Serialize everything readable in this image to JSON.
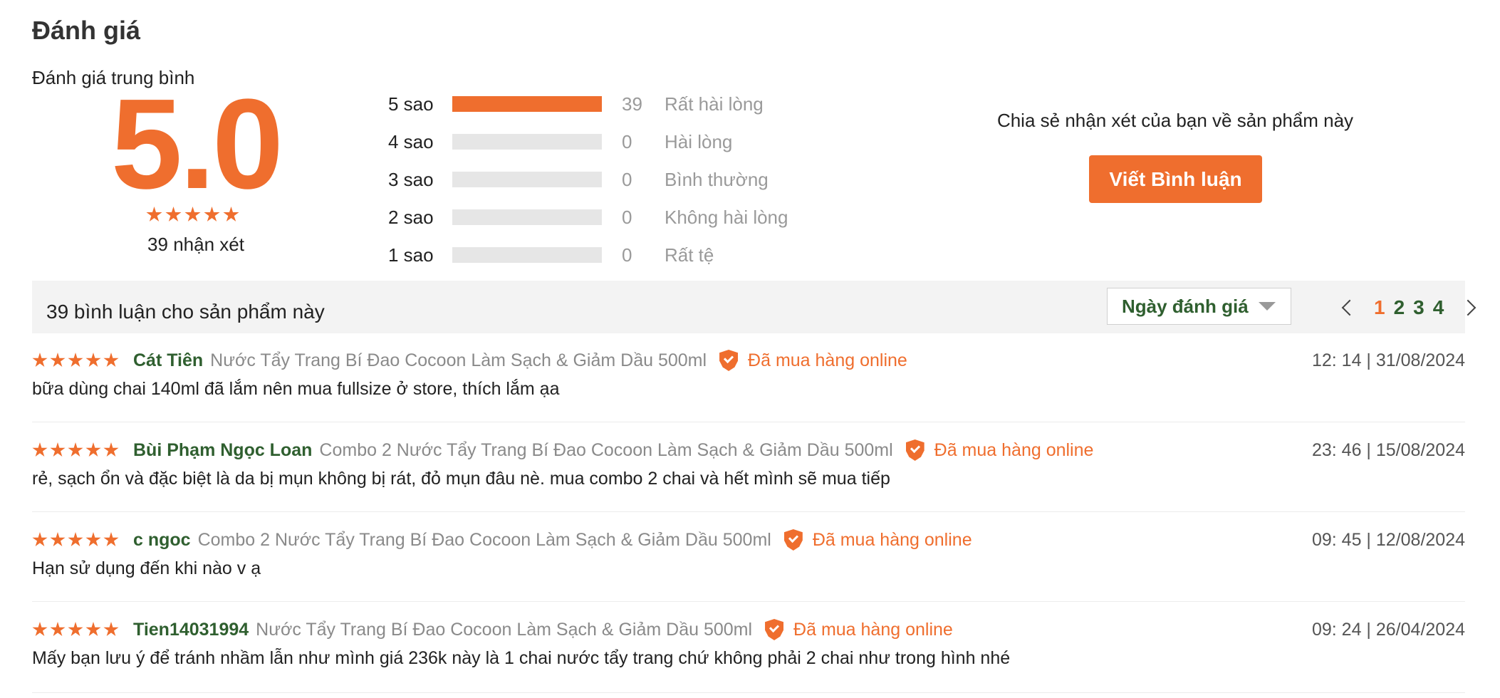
{
  "title": "Đánh giá",
  "summary": {
    "avg_label": "Đánh giá trung bình",
    "avg_value": "5.0",
    "rating": 5,
    "count_text": "39 nhận xét"
  },
  "distribution": [
    {
      "label": "5 sao",
      "count": "39",
      "text": "Rất hài lòng",
      "fraction": 1.0
    },
    {
      "label": "4 sao",
      "count": "0",
      "text": "Hài lòng",
      "fraction": 0
    },
    {
      "label": "3 sao",
      "count": "0",
      "text": "Bình thường",
      "fraction": 0
    },
    {
      "label": "2 sao",
      "count": "0",
      "text": "Không hài lòng",
      "fraction": 0
    },
    {
      "label": "1 sao",
      "count": "0",
      "text": "Rất tệ",
      "fraction": 0
    }
  ],
  "share": {
    "text": "Chia sẻ nhận xét của bạn về sản phẩm này",
    "button_label": "Viết Bình luận"
  },
  "list_header": {
    "title": "39 bình luận cho sản phẩm này",
    "sort_label": "Ngày đánh giá",
    "pages": [
      "1",
      "2",
      "3",
      "4"
    ],
    "current_page": "1"
  },
  "reviews": [
    {
      "stars": 5,
      "author": "Cát Tiên",
      "product": "Nước Tẩy Trang Bí Đao Cocoon Làm Sạch & Giảm Dầu 500ml",
      "badge": "Đã mua hàng online",
      "time": "12: 14 | 31/08/2024",
      "content": "bữa dùng chai 140ml đã lắm nên mua fullsize ở store, thích lắm ạa"
    },
    {
      "stars": 5,
      "author": "Bùi Phạm Ngọc Loan",
      "product": "Combo 2 Nước Tẩy Trang Bí Đao Cocoon Làm Sạch & Giảm Dầu 500ml",
      "badge": "Đã mua hàng online",
      "time": "23: 46 | 15/08/2024",
      "content": "rẻ, sạch ổn và đặc biệt là da bị mụn không bị rát, đỏ mụn đâu nè. mua combo 2 chai và hết mình sẽ mua tiếp"
    },
    {
      "stars": 5,
      "author": "c ngoc",
      "product": "Combo 2 Nước Tẩy Trang Bí Đao Cocoon Làm Sạch & Giảm Dầu 500ml",
      "badge": "Đã mua hàng online",
      "time": "09: 45 | 12/08/2024",
      "content": "Hạn sử dụng đến khi nào v ạ"
    },
    {
      "stars": 5,
      "author": "Tien14031994",
      "product": "Nước Tẩy Trang Bí Đao Cocoon Làm Sạch & Giảm Dầu 500ml",
      "badge": "Đã mua hàng online",
      "time": "09: 24 | 26/04/2024",
      "content": "Mấy bạn lưu ý để tránh nhầm lẫn như mình giá 236k này là 1 chai nước tẩy trang chứ không phải 2 chai như trong hình nhé"
    }
  ],
  "colors": {
    "accent": "#ef6e2e",
    "author": "#2f5f2f",
    "muted": "#9a9a9a"
  },
  "icons": {
    "star": "star-icon",
    "verified": "shield-check-icon",
    "prev": "chevron-left-icon",
    "next": "chevron-right-icon",
    "sort": "caret-down-icon"
  }
}
